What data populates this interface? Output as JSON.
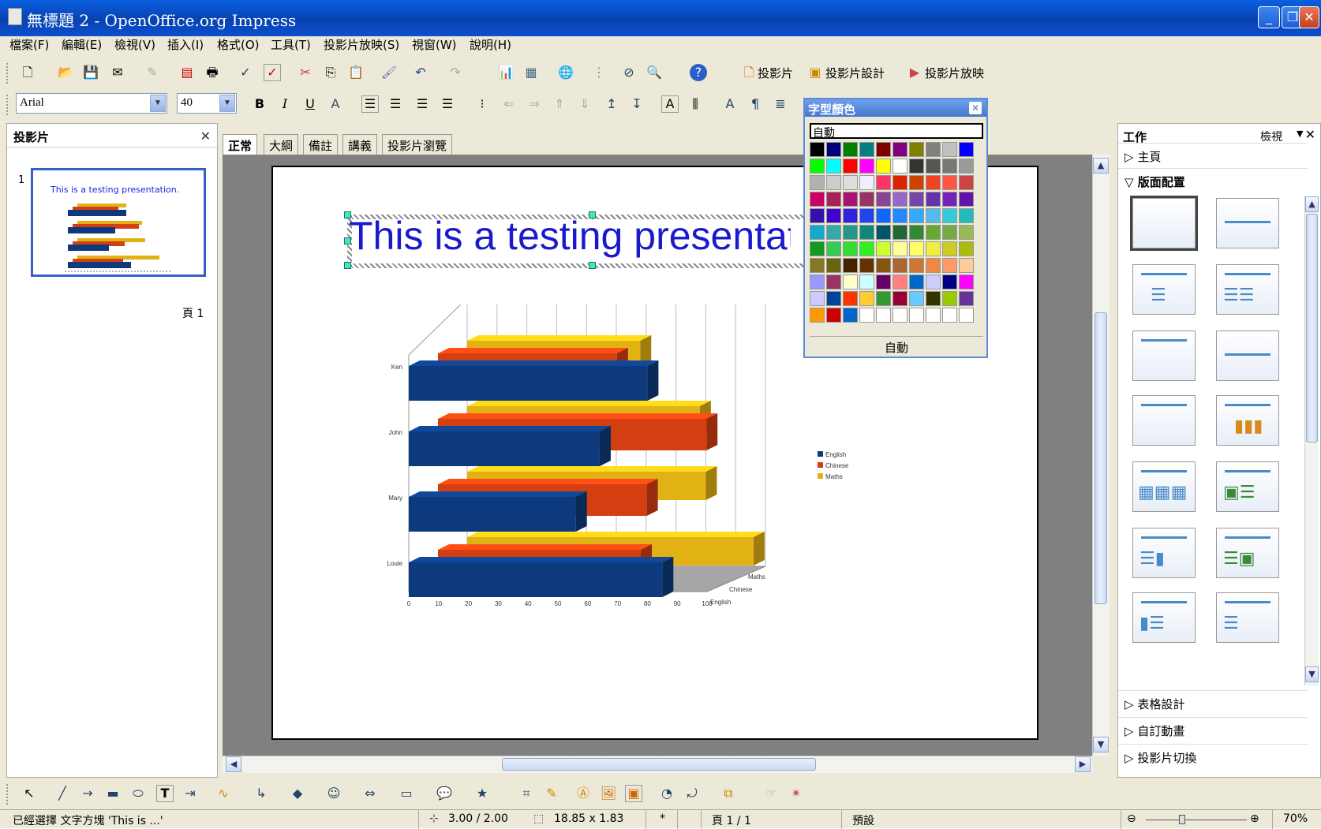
{
  "window": {
    "title": "無標題 2 - OpenOffice.org Impress",
    "minimize": "_",
    "restore": "❐",
    "close": "✕"
  },
  "menu": [
    "檔案(F)",
    "編輯(E)",
    "檢視(V)",
    "插入(I)",
    "格式(O)",
    "工具(T)",
    "投影片放映(S)",
    "視窗(W)",
    "說明(H)"
  ],
  "toolbar": {
    "slide_label": "投影片",
    "slide_design_label": "投影片設計",
    "slideshow_label": "投影片放映",
    "font_name": "Arial",
    "font_size": "40"
  },
  "slides_pane": {
    "title": "投影片",
    "slide_number": "1",
    "thumbnail_title": "This is a testing presentation.",
    "page_label": "頁 1"
  },
  "view_tabs": [
    "正常",
    "大綱",
    "備註",
    "講義",
    "投影片瀏覽"
  ],
  "slide": {
    "title": "This is a testing presentation."
  },
  "chart_data": {
    "type": "bar",
    "orientation": "horizontal-3d",
    "categories": [
      "Ken",
      "John",
      "Mary",
      "Louie"
    ],
    "series": [
      {
        "name": "English",
        "values": [
          80,
          64,
          56,
          85
        ],
        "color": "#0d3a7c"
      },
      {
        "name": "Chinese",
        "values": [
          60,
          90,
          70,
          68
        ],
        "color": "#d43f12"
      },
      {
        "name": "Maths",
        "values": [
          58,
          78,
          80,
          96
        ],
        "color": "#e2b114"
      }
    ],
    "x_ticks": [
      "0",
      "10",
      "20",
      "30",
      "40",
      "50",
      "60",
      "70",
      "80",
      "90",
      "100"
    ],
    "depth_labels": [
      "Maths",
      "Chinese",
      "English"
    ],
    "xlim": [
      0,
      100
    ],
    "legend": "right",
    "grid": true
  },
  "color_palette": {
    "title": "字型顏色",
    "auto_top": "自動",
    "auto_bottom": "自動",
    "close": "✕",
    "colors": [
      [
        "#000000",
        "#000080",
        "#008000",
        "#008080",
        "#800000",
        "#800080",
        "#808000",
        "#808080",
        "#c0c0c0",
        "#0000ff"
      ],
      [
        "#00ff00",
        "#00ffff",
        "#ff0000",
        "#ff00ff",
        "#ffff00",
        "#ffffff",
        "#333333",
        "#555555",
        "#777777",
        "#999999"
      ],
      [
        "#b2b2b2",
        "#cccccc",
        "#dddddd",
        "#eeeeff",
        "#ff3366",
        "#dd2200",
        "#cc4400",
        "#ee4422",
        "#ff5544",
        "#cc4444"
      ],
      [
        "#cc0066",
        "#aa2255",
        "#aa1177",
        "#993366",
        "#884499",
        "#9966cc",
        "#7744aa",
        "#6633aa",
        "#7722bb",
        "#6611aa"
      ],
      [
        "#3311aa",
        "#4400cc",
        "#3322dd",
        "#2244ee",
        "#1166ff",
        "#2288ff",
        "#33aaff",
        "#55bbee",
        "#33ccdd",
        "#22bbbb"
      ],
      [
        "#11aacc",
        "#33aaaa",
        "#229988",
        "#118877",
        "#005566",
        "#226633",
        "#338833",
        "#66aa33",
        "#77aa44",
        "#99bb55"
      ],
      [
        "#119922",
        "#33cc55",
        "#33dd33",
        "#33ee22",
        "#ccff33",
        "#ffff99",
        "#ffff66",
        "#eeee44",
        "#cccc22",
        "#aabb11"
      ],
      [
        "#887722",
        "#666611",
        "#442200",
        "#663300",
        "#885511",
        "#aa6633",
        "#cc7733",
        "#ee8844",
        "#ff9966",
        "#ffcc99"
      ],
      [
        "#9999ff",
        "#993366",
        "#ffffcc",
        "#ccffff",
        "#660066",
        "#ff8080",
        "#0066cc",
        "#ccccff",
        "#000080",
        "#ff00ff"
      ],
      [
        "#ccccff",
        "#004499",
        "#ff3300",
        "#ffcc33",
        "#339933",
        "#990033",
        "#66ccff",
        "#333300",
        "#99cc00",
        "#663399"
      ],
      [
        "#ff9900",
        "#cc0000",
        "#0066cc",
        "#ffffff",
        "#ffffff",
        "#ffffff",
        "#ffffff",
        "#ffffff",
        "#ffffff",
        "#ffffff"
      ]
    ]
  },
  "task_pane": {
    "title": "工作",
    "view_label": "檢視",
    "sections": {
      "master": "主頁",
      "layouts": "版面配置",
      "table_design": "表格設計",
      "custom_animation": "自訂動畫",
      "slide_transition": "投影片切換"
    }
  },
  "status": {
    "selection": "已經選擇 文字方塊 'This is ...'",
    "position": "3.00 / 2.00",
    "size": "18.85 x 1.83",
    "modified": "*",
    "page": "頁 1 / 1",
    "style": "預設",
    "zoom": "70%"
  }
}
